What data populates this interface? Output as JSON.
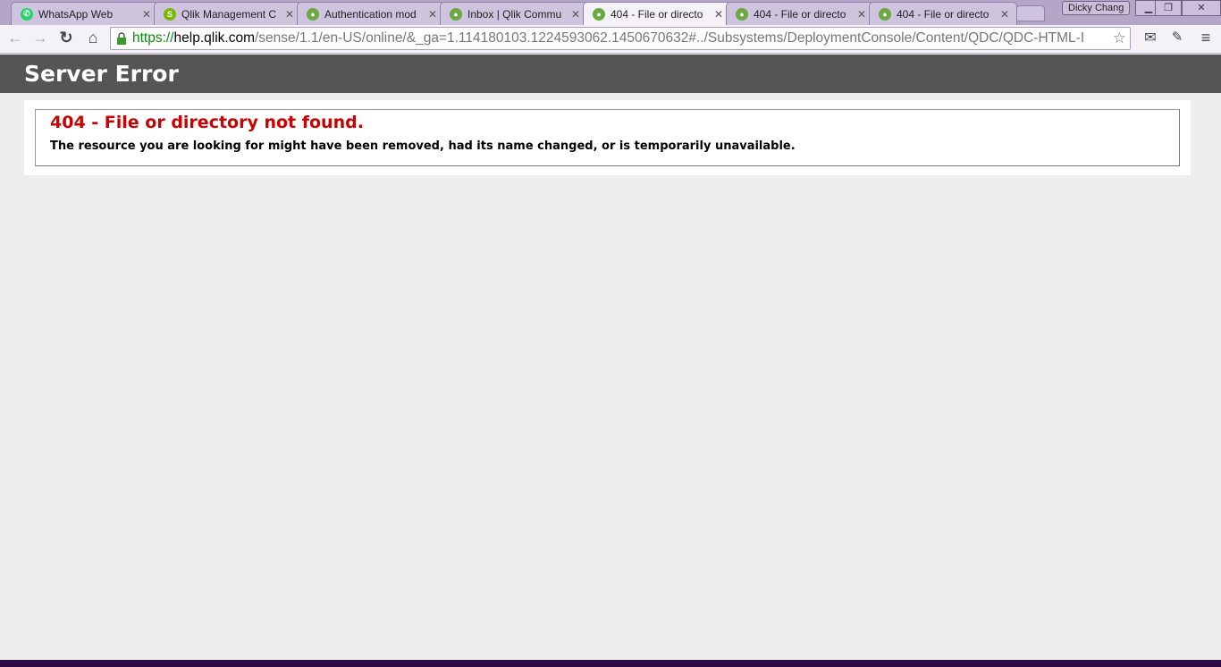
{
  "browser": {
    "tabs": [
      {
        "title": "WhatsApp Web",
        "icon": "whatsapp-icon",
        "color": "#25d366"
      },
      {
        "title": "Qlik Management C",
        "icon": "qlik-sense-icon",
        "color": "#7ab800"
      },
      {
        "title": "Authentication mod",
        "icon": "qlik-icon",
        "color": "#6aa842"
      },
      {
        "title": "Inbox | Qlik Commu",
        "icon": "qlik-icon",
        "color": "#6aa842"
      },
      {
        "title": "404 - File or directo",
        "icon": "qlik-icon",
        "color": "#6aa842",
        "active": true
      },
      {
        "title": "404 - File or directo",
        "icon": "qlik-icon",
        "color": "#6aa842"
      },
      {
        "title": "404 - File or directo",
        "icon": "qlik-icon",
        "color": "#6aa842"
      }
    ],
    "user": "Dicky Chang",
    "url": {
      "scheme": "https://",
      "domain": "help.qlik.com",
      "path": "/sense/1.1/en-US/online/&_ga=1.114180103.1224593062.1450670632#../Subsystems/DeploymentConsole/Content/QDC/QDC-HTML-I"
    }
  },
  "page": {
    "header": "Server Error",
    "error_title": "404 - File or directory not found.",
    "error_message": "The resource you are looking for might have been removed, had its name changed, or is temporarily unavailable."
  }
}
